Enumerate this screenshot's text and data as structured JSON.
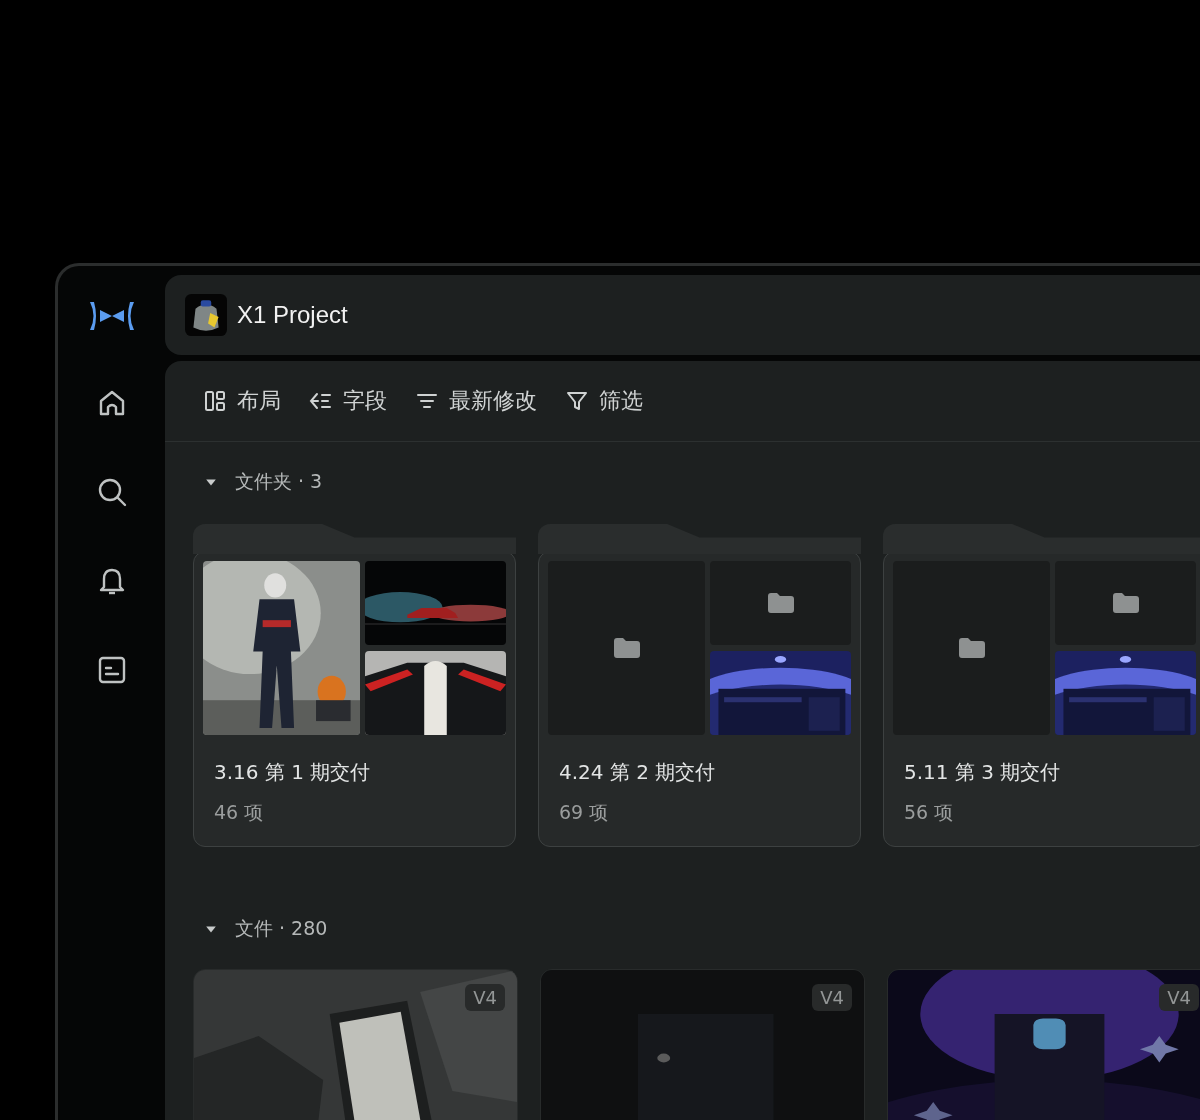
{
  "header": {
    "title": "X1 Project"
  },
  "toolbar": [
    {
      "kind": "layout",
      "label": "布局"
    },
    {
      "kind": "fields",
      "label": "字段"
    },
    {
      "kind": "sort",
      "label": "最新修改"
    },
    {
      "kind": "filter",
      "label": "筛选"
    }
  ],
  "folders_section": {
    "label": "文件夹 · 3",
    "expanded": true
  },
  "folders": [
    {
      "title": "3.16 第 1 期交付",
      "count": "46 项",
      "thumbs": [
        {
          "kind": "picture"
        },
        {
          "kind": "picture"
        },
        {
          "kind": "picture"
        }
      ]
    },
    {
      "title": "4.24 第 2 期交付",
      "count": "69 项",
      "thumbs": [
        {
          "kind": "folder"
        },
        {
          "kind": "folder"
        },
        {
          "kind": "picture"
        }
      ]
    },
    {
      "title": "5.11 第 3 期交付",
      "count": "56 项",
      "thumbs": [
        {
          "kind": "folder"
        },
        {
          "kind": "folder"
        },
        {
          "kind": "picture"
        }
      ]
    }
  ],
  "files_section": {
    "label": "文件 · 280",
    "expanded": true
  },
  "files": [
    {
      "version": "V4"
    },
    {
      "version": "V4"
    },
    {
      "version": "V4"
    }
  ]
}
